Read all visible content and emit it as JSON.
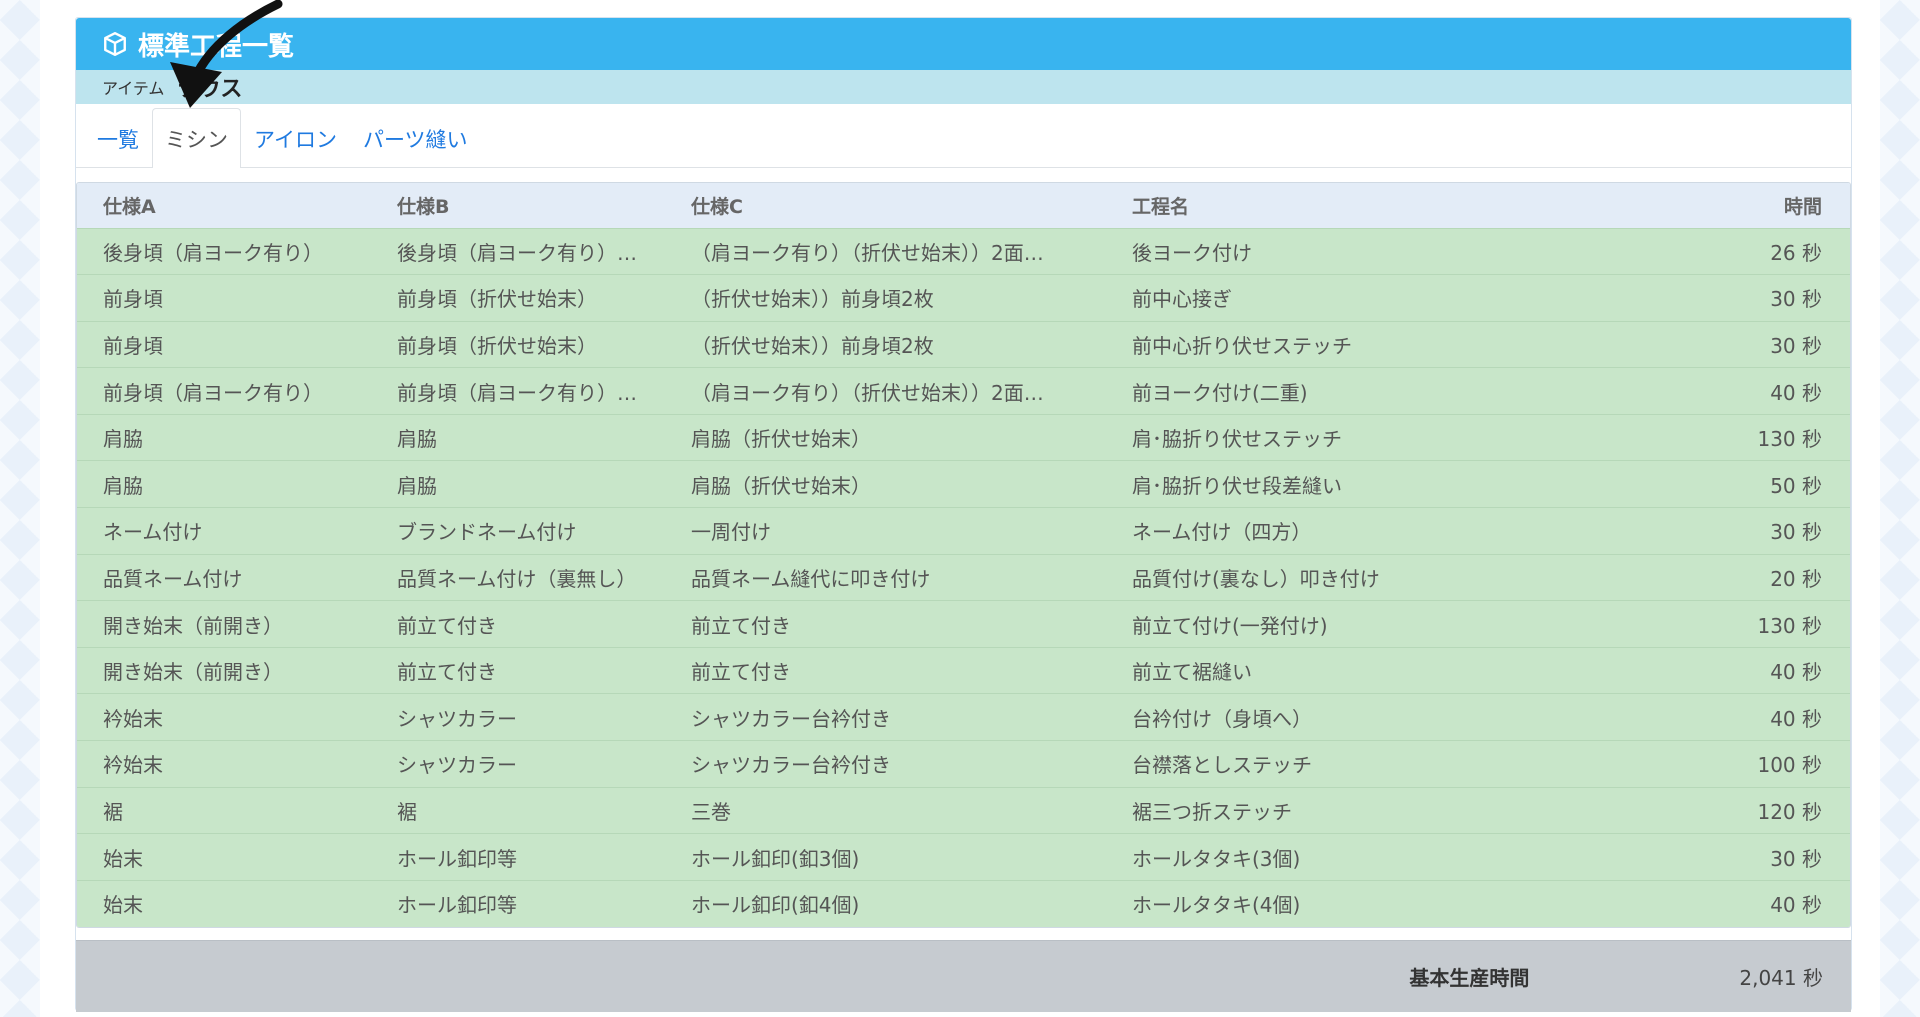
{
  "header": {
    "title": "標準工程一覧"
  },
  "subheader": {
    "label": "アイテム",
    "value": "ラウス"
  },
  "tabs": [
    {
      "label": "一覧",
      "active": false
    },
    {
      "label": "ミシン",
      "active": true
    },
    {
      "label": "アイロン",
      "active": false
    },
    {
      "label": "パーツ縫い",
      "active": false
    }
  ],
  "table": {
    "columns": [
      "仕様A",
      "仕様B",
      "仕様C",
      "工程名",
      "時間"
    ],
    "rows": [
      [
        "後身頃（肩ヨーク有り）",
        "後身頃（肩ヨーク有り）…",
        "（肩ヨーク有り）（折伏せ始末））2面…",
        "後ヨーク付け",
        "26 秒"
      ],
      [
        "前身頃",
        "前身頃（折伏せ始末）",
        "（折伏せ始末））前身頃2枚",
        "前中心接ぎ",
        "30 秒"
      ],
      [
        "前身頃",
        "前身頃（折伏せ始末）",
        "（折伏せ始末））前身頃2枚",
        "前中心折り伏せステッチ",
        "30 秒"
      ],
      [
        "前身頃（肩ヨーク有り）",
        "前身頃（肩ヨーク有り）…",
        "（肩ヨーク有り）（折伏せ始末））2面…",
        "前ヨーク付け(二重)",
        "40 秒"
      ],
      [
        "肩脇",
        "肩脇",
        "肩脇（折伏せ始末）",
        "肩･脇折り伏せステッチ",
        "130 秒"
      ],
      [
        "肩脇",
        "肩脇",
        "肩脇（折伏せ始末）",
        "肩･脇折り伏せ段差縫い",
        "50 秒"
      ],
      [
        "ネーム付け",
        "ブランドネーム付け",
        "一周付け",
        "ネーム付け（四方）",
        "30 秒"
      ],
      [
        "品質ネーム付け",
        "品質ネーム付け（裏無し）",
        "品質ネーム縫代に叩き付け",
        "品質付け(裏なし）叩き付け",
        "20 秒"
      ],
      [
        "開き始末（前開き）",
        "前立て付き",
        "前立て付き",
        "前立て付け(一発付け)",
        "130 秒"
      ],
      [
        "開き始末（前開き）",
        "前立て付き",
        "前立て付き",
        "前立て裾縫い",
        "40 秒"
      ],
      [
        "衿始末",
        "シャツカラー",
        "シャツカラー台衿付き",
        "台衿付け（身頃へ）",
        "40 秒"
      ],
      [
        "衿始末",
        "シャツカラー",
        "シャツカラー台衿付き",
        "台襟落としステッチ",
        "100 秒"
      ],
      [
        "裾",
        "裾",
        "三巻",
        "裾三つ折ステッチ",
        "120 秒"
      ],
      [
        "始末",
        "ホール釦印等",
        "ホール釦印(釦3個)",
        "ホールタタキ(3個)",
        "30 秒"
      ],
      [
        "始末",
        "ホール釦印等",
        "ホール釦印(釦4個)",
        "ホールタタキ(4個)",
        "40 秒"
      ]
    ]
  },
  "summary": {
    "label": "基本生産時間",
    "value": "2,041 秒"
  },
  "colors": {
    "header": "#39b4ef",
    "subheader": "#bde4ee",
    "row": "#c8e6c9",
    "thead": "#e3ecf7",
    "summary": "#c6cbd0"
  },
  "icons": {
    "header": "cube-icon",
    "overlay": "arrow-pointer-icon"
  }
}
